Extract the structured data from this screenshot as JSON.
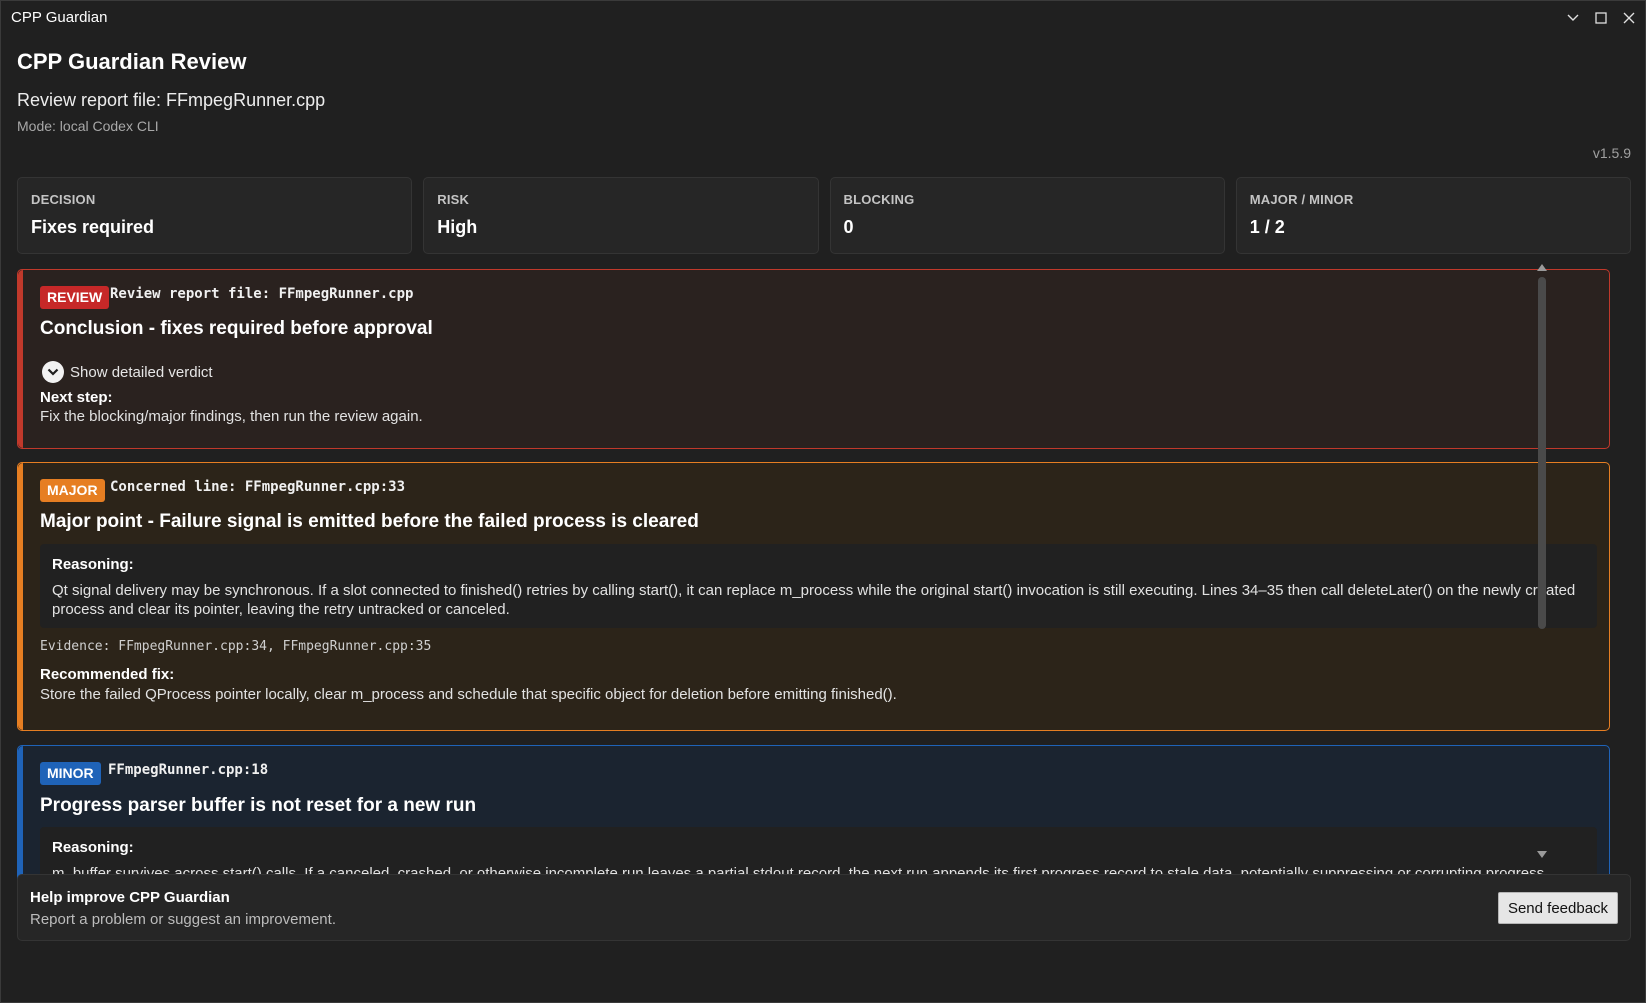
{
  "window": {
    "title": "CPP Guardian"
  },
  "header": {
    "title": "CPP Guardian Review",
    "subtitle": "Review report file: FFmpegRunner.cpp",
    "mode": "Mode: local Codex CLI",
    "version": "v1.5.9"
  },
  "summary": [
    {
      "label": "DECISION",
      "value": "Fixes required"
    },
    {
      "label": "RISK",
      "value": "High"
    },
    {
      "label": "BLOCKING",
      "value": "0"
    },
    {
      "label": "MAJOR / MINOR",
      "value": "1 / 2"
    }
  ],
  "findings": {
    "review": {
      "badge": "REVIEW",
      "heading": "Review report file: FFmpegRunner.cpp",
      "title": "Conclusion - fixes required before approval",
      "toggle_label": "Show detailed verdict",
      "next_step_label": "Next step:",
      "next_step_text": "Fix the blocking/major findings, then run the review again."
    },
    "major": {
      "badge": "MAJOR",
      "heading": "Concerned line: FFmpegRunner.cpp:33",
      "title": "Major point - Failure signal is emitted before the failed process is cleared",
      "reasoning_label": "Reasoning:",
      "reasoning_text": "Qt signal delivery may be synchronous. If a slot connected to finished() retries by calling start(), it can replace m_process while the original start() invocation is still executing. Lines 34–35 then call deleteLater() on the newly created process and clear its pointer, leaving the retry untracked or canceled.",
      "evidence": "Evidence: FFmpegRunner.cpp:34, FFmpegRunner.cpp:35",
      "fix_label": "Recommended fix:",
      "fix_text": "Store the failed QProcess pointer locally, clear m_process and schedule that specific object for deletion before emitting finished()."
    },
    "minor": {
      "badge": "MINOR",
      "heading": "FFmpegRunner.cpp:18",
      "title": "Progress parser buffer is not reset for a new run",
      "reasoning_label": "Reasoning:",
      "reasoning_text": "m_buffer survives across start() calls. If a canceled, crashed, or otherwise incomplete run leaves a partial stdout record, the next run appends its first progress record to stale data, potentially suppressing or corrupting progress parsing."
    }
  },
  "feedback": {
    "title": "Help improve CPP Guardian",
    "subtitle": "Report a problem or suggest an improvement.",
    "button": "Send feedback"
  },
  "icons": {
    "minimize": "chevron-down-icon",
    "maximize": "maximize-icon",
    "close": "close-icon",
    "toggle": "chevron-circle-down-icon"
  },
  "colors": {
    "review": "#c0392b",
    "major": "#e67e22",
    "minor": "#1f63b8",
    "background": "#202020"
  }
}
